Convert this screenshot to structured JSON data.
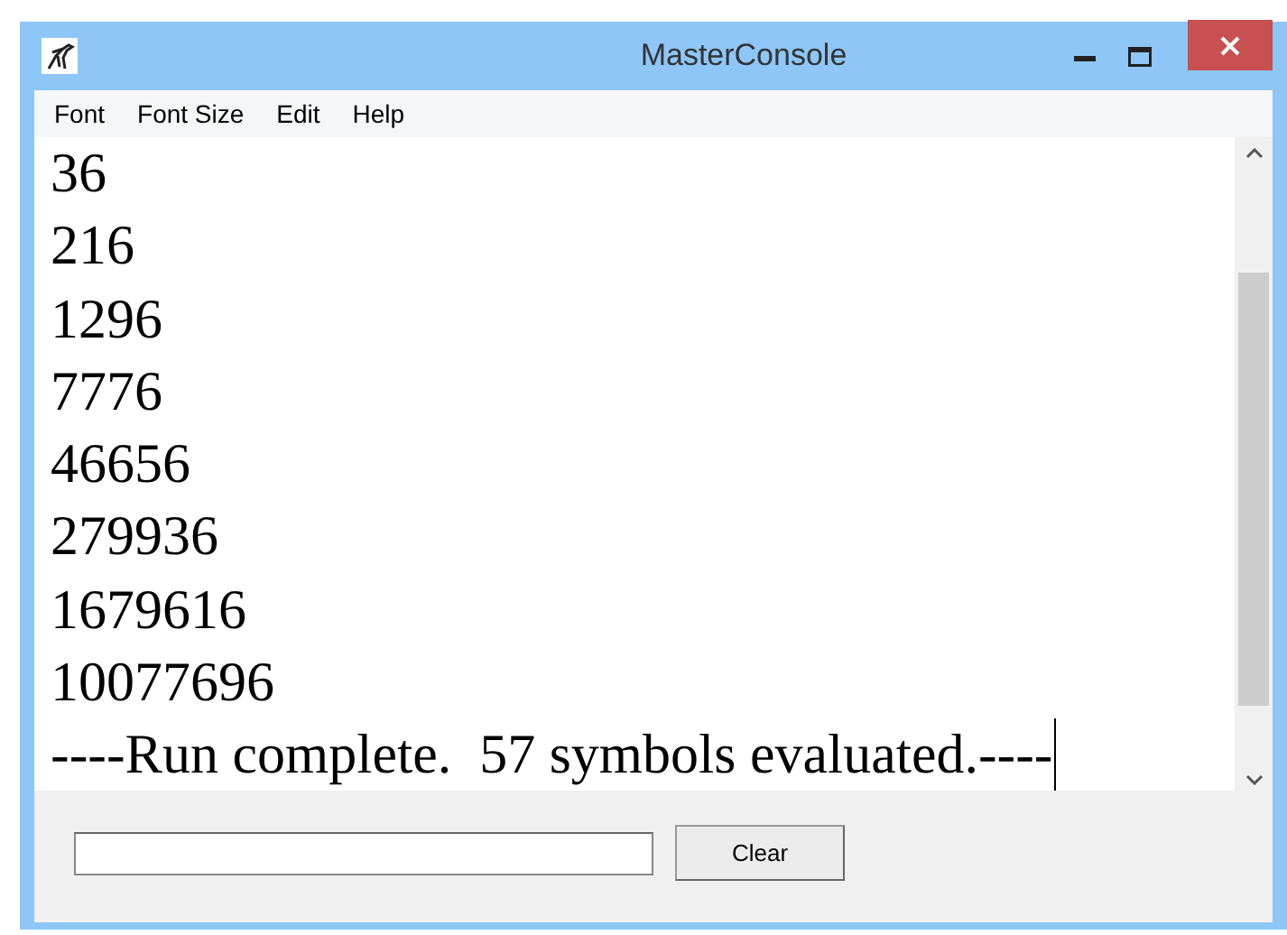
{
  "window": {
    "title": "MasterConsole"
  },
  "menu": [
    "Font",
    "Font Size",
    "Edit",
    "Help"
  ],
  "output_lines": [
    "36",
    "216",
    "1296",
    "7776",
    "46656",
    "279936",
    "1679616",
    "10077696",
    "----Run complete.  57 symbols evaluated.----"
  ],
  "buttons": [
    "Clear"
  ]
}
